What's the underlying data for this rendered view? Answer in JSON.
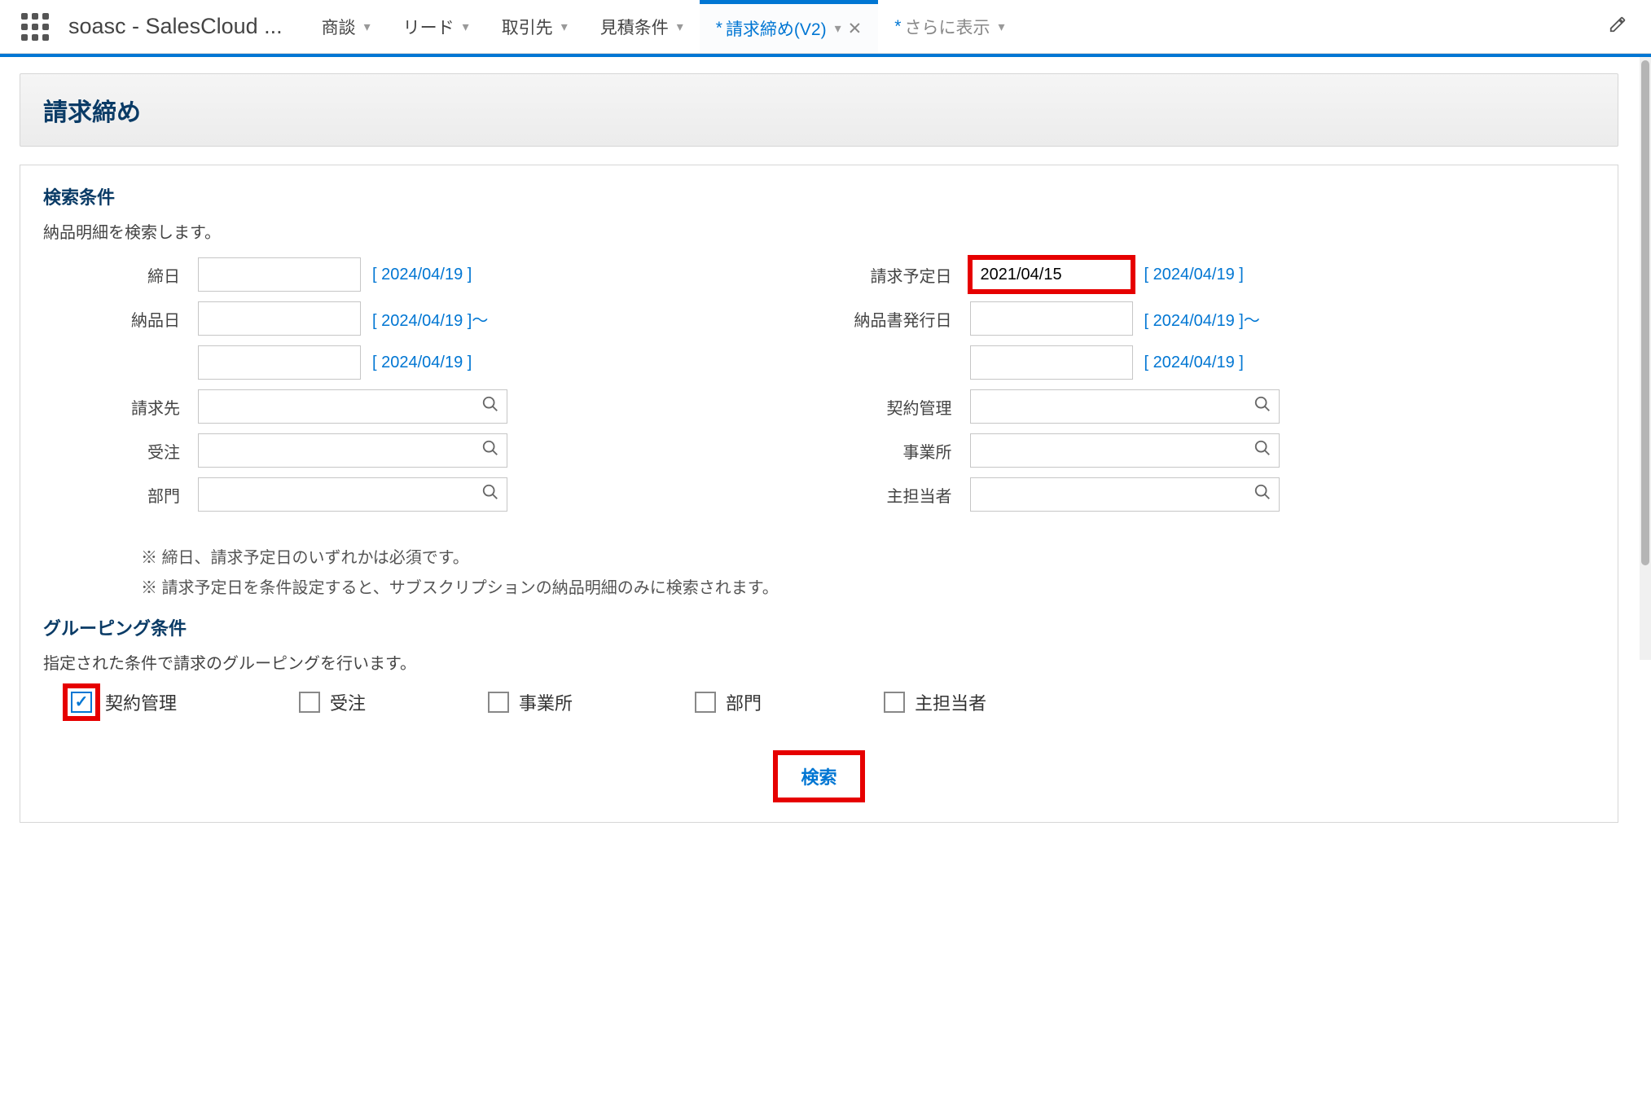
{
  "app": {
    "title": "soasc - SalesCloud ..."
  },
  "nav": {
    "tabs": [
      {
        "label": "商談"
      },
      {
        "label": "リード"
      },
      {
        "label": "取引先"
      },
      {
        "label": "見積条件"
      }
    ],
    "active_tab": "請求締め(V2)",
    "more_label": "さらに表示"
  },
  "page": {
    "title": "請求締め"
  },
  "search_section": {
    "title": "検索条件",
    "desc": "納品明細を検索します。",
    "left": {
      "closing_date": {
        "label": "締日",
        "value": "",
        "hint": "[ 2024/04/19 ]"
      },
      "delivery_date": {
        "label": "納品日",
        "from": "",
        "from_hint": "[ 2024/04/19 ]～",
        "to": "",
        "to_hint": "[ 2024/04/19 ]"
      },
      "billing_to": {
        "label": "請求先",
        "value": ""
      },
      "order": {
        "label": "受注",
        "value": ""
      },
      "department": {
        "label": "部門",
        "value": ""
      }
    },
    "right": {
      "scheduled_date": {
        "label": "請求予定日",
        "value": "2021/04/15",
        "hint": "[ 2024/04/19 ]"
      },
      "issue_date": {
        "label": "納品書発行日",
        "from": "",
        "from_hint": "[ 2024/04/19 ]～",
        "to": "",
        "to_hint": "[ 2024/04/19 ]"
      },
      "contract": {
        "label": "契約管理",
        "value": ""
      },
      "office": {
        "label": "事業所",
        "value": ""
      },
      "owner": {
        "label": "主担当者",
        "value": ""
      }
    },
    "notes": {
      "n1": "※ 締日、請求予定日のいずれかは必須です。",
      "n2": "※ 請求予定日を条件設定すると、サブスクリプションの納品明細のみに検索されます。"
    }
  },
  "group_section": {
    "title": "グルーピング条件",
    "desc": "指定された条件で請求のグルーピングを行います。",
    "options": {
      "contract": {
        "label": "契約管理",
        "checked": true
      },
      "order": {
        "label": "受注",
        "checked": false
      },
      "office": {
        "label": "事業所",
        "checked": false
      },
      "department": {
        "label": "部門",
        "checked": false
      },
      "owner": {
        "label": "主担当者",
        "checked": false
      }
    }
  },
  "actions": {
    "search": "検索"
  }
}
